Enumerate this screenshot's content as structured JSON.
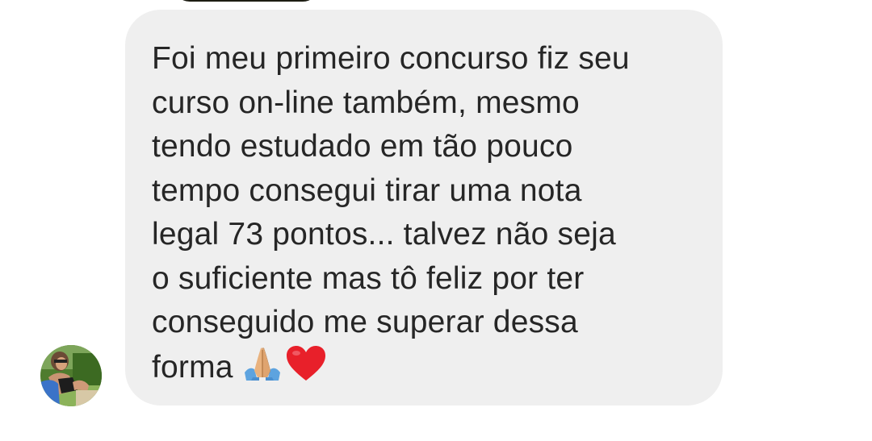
{
  "message": {
    "lines": [
      "Foi meu primeiro concurso fiz seu",
      "curso on-line também, mesmo",
      "tendo estudado em tão pouco",
      "tempo consegui tirar uma nota",
      "legal 73 pontos... talvez não seja",
      "o suficiente mas tô feliz por ter",
      "conseguido me superar dessa",
      "forma"
    ],
    "emojis": [
      "praying-hands-emoji",
      "red-heart-emoji"
    ]
  },
  "sender": {
    "avatar": "profile-avatar"
  },
  "colors": {
    "bubble_bg": "#efefef",
    "text": "#262626",
    "heart": "#e8202a",
    "hands": "#e9b27e",
    "sleeves": "#5da3df"
  }
}
